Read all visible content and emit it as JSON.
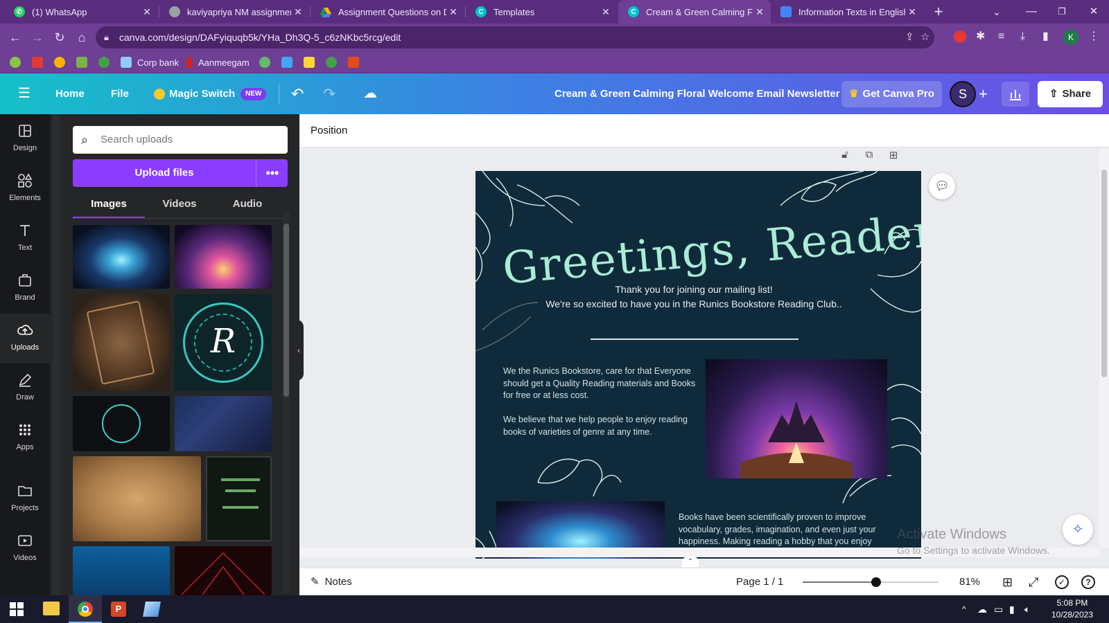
{
  "browser": {
    "tabs": [
      {
        "title": "(1) WhatsApp",
        "icon": "whatsapp-icon",
        "color": "#25d366"
      },
      {
        "title": "kaviyapriya NM assignment c",
        "icon": "globe-icon",
        "color": "#9aa0a6"
      },
      {
        "title": "Assignment Questions on Di",
        "icon": "drive-icon",
        "color": "#fbbc04"
      },
      {
        "title": "Templates",
        "icon": "canva-icon",
        "color": "#00c4cc"
      },
      {
        "title": "Cream & Green Calming Flor",
        "icon": "canva-icon",
        "color": "#00c4cc"
      },
      {
        "title": "Information Texts in English",
        "icon": "slides-icon",
        "color": "#4285f4"
      }
    ],
    "url": "canva.com/design/DAFyiquqb5k/YHa_Dh3Q-5_c6zNKbc5rcg/edit",
    "profile_initial": "K",
    "bookmarks": [
      {
        "label": "",
        "color": "#8bc34a"
      },
      {
        "label": "",
        "color": "#e53935"
      },
      {
        "label": "",
        "color": "#ffb300"
      },
      {
        "label": "",
        "color": "#7cb342"
      },
      {
        "label": "",
        "color": "#43a047"
      },
      {
        "label": "Corp bank",
        "color": "#90caf9"
      },
      {
        "label": "Aanmeegam",
        "color": "#c62828"
      },
      {
        "label": "",
        "color": "#66bb6a"
      },
      {
        "label": "",
        "color": "#42a5f5"
      },
      {
        "label": "",
        "color": "#fdd835"
      },
      {
        "label": "",
        "color": "#43a047"
      },
      {
        "label": "",
        "color": "#e64a19"
      }
    ]
  },
  "canva": {
    "home": "Home",
    "file": "File",
    "magic_switch": "Magic Switch",
    "new_badge": "NEW",
    "design_title": "Cream & Green Calming Floral Welcome Email Newsletter",
    "get_pro": "Get Canva Pro",
    "avatar_initial": "S",
    "share": "Share"
  },
  "rail": [
    {
      "label": "Design",
      "icon": "layout-icon"
    },
    {
      "label": "Elements",
      "icon": "shapes-icon"
    },
    {
      "label": "Text",
      "icon": "text-icon"
    },
    {
      "label": "Brand",
      "icon": "brand-icon"
    },
    {
      "label": "Uploads",
      "icon": "upload-cloud-icon",
      "active": true
    },
    {
      "label": "Draw",
      "icon": "pen-icon"
    },
    {
      "label": "Apps",
      "icon": "apps-grid-icon"
    },
    {
      "label": "Projects",
      "icon": "folder-icon"
    },
    {
      "label": "Videos",
      "icon": "video-icon"
    }
  ],
  "uploads": {
    "search_placeholder": "Search uploads",
    "upload_button": "Upload files",
    "tabs": [
      "Images",
      "Videos",
      "Audio"
    ],
    "active_tab": "Images"
  },
  "editor": {
    "toolbar_label": "Position",
    "notes": "Notes",
    "page_indicator": "Page 1 / 1",
    "zoom": "81%",
    "zoom_fraction": 0.54
  },
  "design": {
    "heading": "Greetings, Reader !!",
    "subtitle_line1": "Thank you for joining our mailing list!",
    "subtitle_line2": "We're so excited to have you in the Runics Bookstore Reading Club..",
    "para1": "We the Runics Bookstore, care for that Everyone should get a Quality Reading materials and Books for free or at less cost.",
    "para2": "We believe that we help people to enjoy reading books of varieties of genre at any time.",
    "para3": "Books have been scientifically proven to improve vocabulary, grades, imagination, and even just your happiness. Making reading a hobby that you enjoy"
  },
  "watermark": {
    "line1": "Activate Windows",
    "line2": "Go to Settings to activate Windows."
  },
  "taskbar": {
    "time": "5:08 PM",
    "date": "10/28/2023"
  }
}
